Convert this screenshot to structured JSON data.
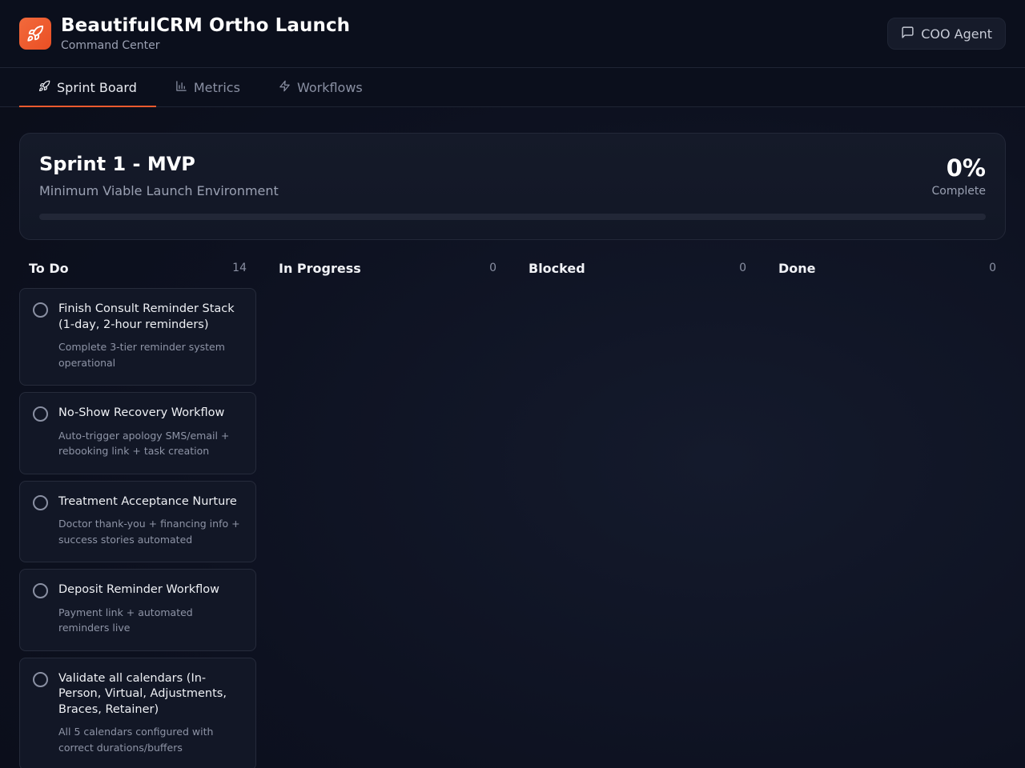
{
  "header": {
    "title": "BeautifulCRM Ortho Launch",
    "subtitle": "Command Center",
    "logo_icon": "rocket-icon",
    "coo_button_label": "COO Agent",
    "accent_color": "#ea5a2e"
  },
  "tabs": [
    {
      "label": "Sprint Board",
      "icon": "rocket-icon",
      "active": true
    },
    {
      "label": "Metrics",
      "icon": "bar-chart-icon",
      "active": false
    },
    {
      "label": "Workflows",
      "icon": "lightning-icon",
      "active": false
    }
  ],
  "sprint": {
    "title": "Sprint 1 - MVP",
    "subtitle": "Minimum Viable Launch Environment",
    "percent_label": "0%",
    "percent_caption": "Complete",
    "progress_fraction": 0
  },
  "columns": [
    {
      "title": "To Do",
      "count": "14",
      "cards": [
        {
          "title": "Finish Consult Reminder Stack (1-day, 2-hour reminders)",
          "description": "Complete 3-tier reminder system operational"
        },
        {
          "title": "No-Show Recovery Workflow",
          "description": "Auto-trigger apology SMS/email + rebooking link + task creation"
        },
        {
          "title": "Treatment Acceptance Nurture",
          "description": "Doctor thank-you + financing info + success stories automated"
        },
        {
          "title": "Deposit Reminder Workflow",
          "description": "Payment link + automated reminders live"
        },
        {
          "title": "Validate all calendars (In-Person, Virtual, Adjustments, Braces, Retainer)",
          "description": "All 5 calendars configured with correct durations/buffers"
        }
      ]
    },
    {
      "title": "In Progress",
      "count": "0",
      "cards": []
    },
    {
      "title": "Blocked",
      "count": "0",
      "cards": []
    },
    {
      "title": "Done",
      "count": "0",
      "cards": []
    }
  ]
}
